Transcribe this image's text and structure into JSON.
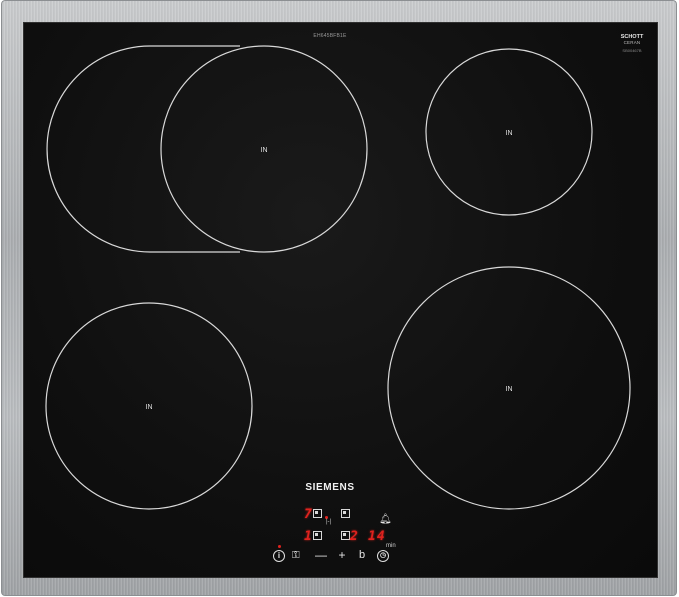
{
  "cooktop": {
    "model_label": "EH645BFB1E",
    "ceran_brand": "SCHOTT",
    "ceran_sub": "CERAN",
    "ceran_code": "SB00467B",
    "brand": "SIEMENS",
    "zone_label": "IN",
    "colors": {
      "glass": "#111111",
      "zone_ring": "#d9d9d9",
      "display_red": "#e0221e",
      "frame": "#b0b3b6"
    }
  },
  "display": {
    "top_left_value": "7",
    "bottom_left_value": "1",
    "timer_hours": "2",
    "timer_minutes": "14",
    "timer_unit": "min",
    "timer_marker": "|-|"
  },
  "controls": {
    "power_icon": "info-power-icon",
    "lock_icon": "key-lock-icon",
    "minus_label": "—",
    "plus_label": "+",
    "b_label": "b",
    "clock_icon": "clock-icon",
    "bell_icon": "bell-icon"
  }
}
